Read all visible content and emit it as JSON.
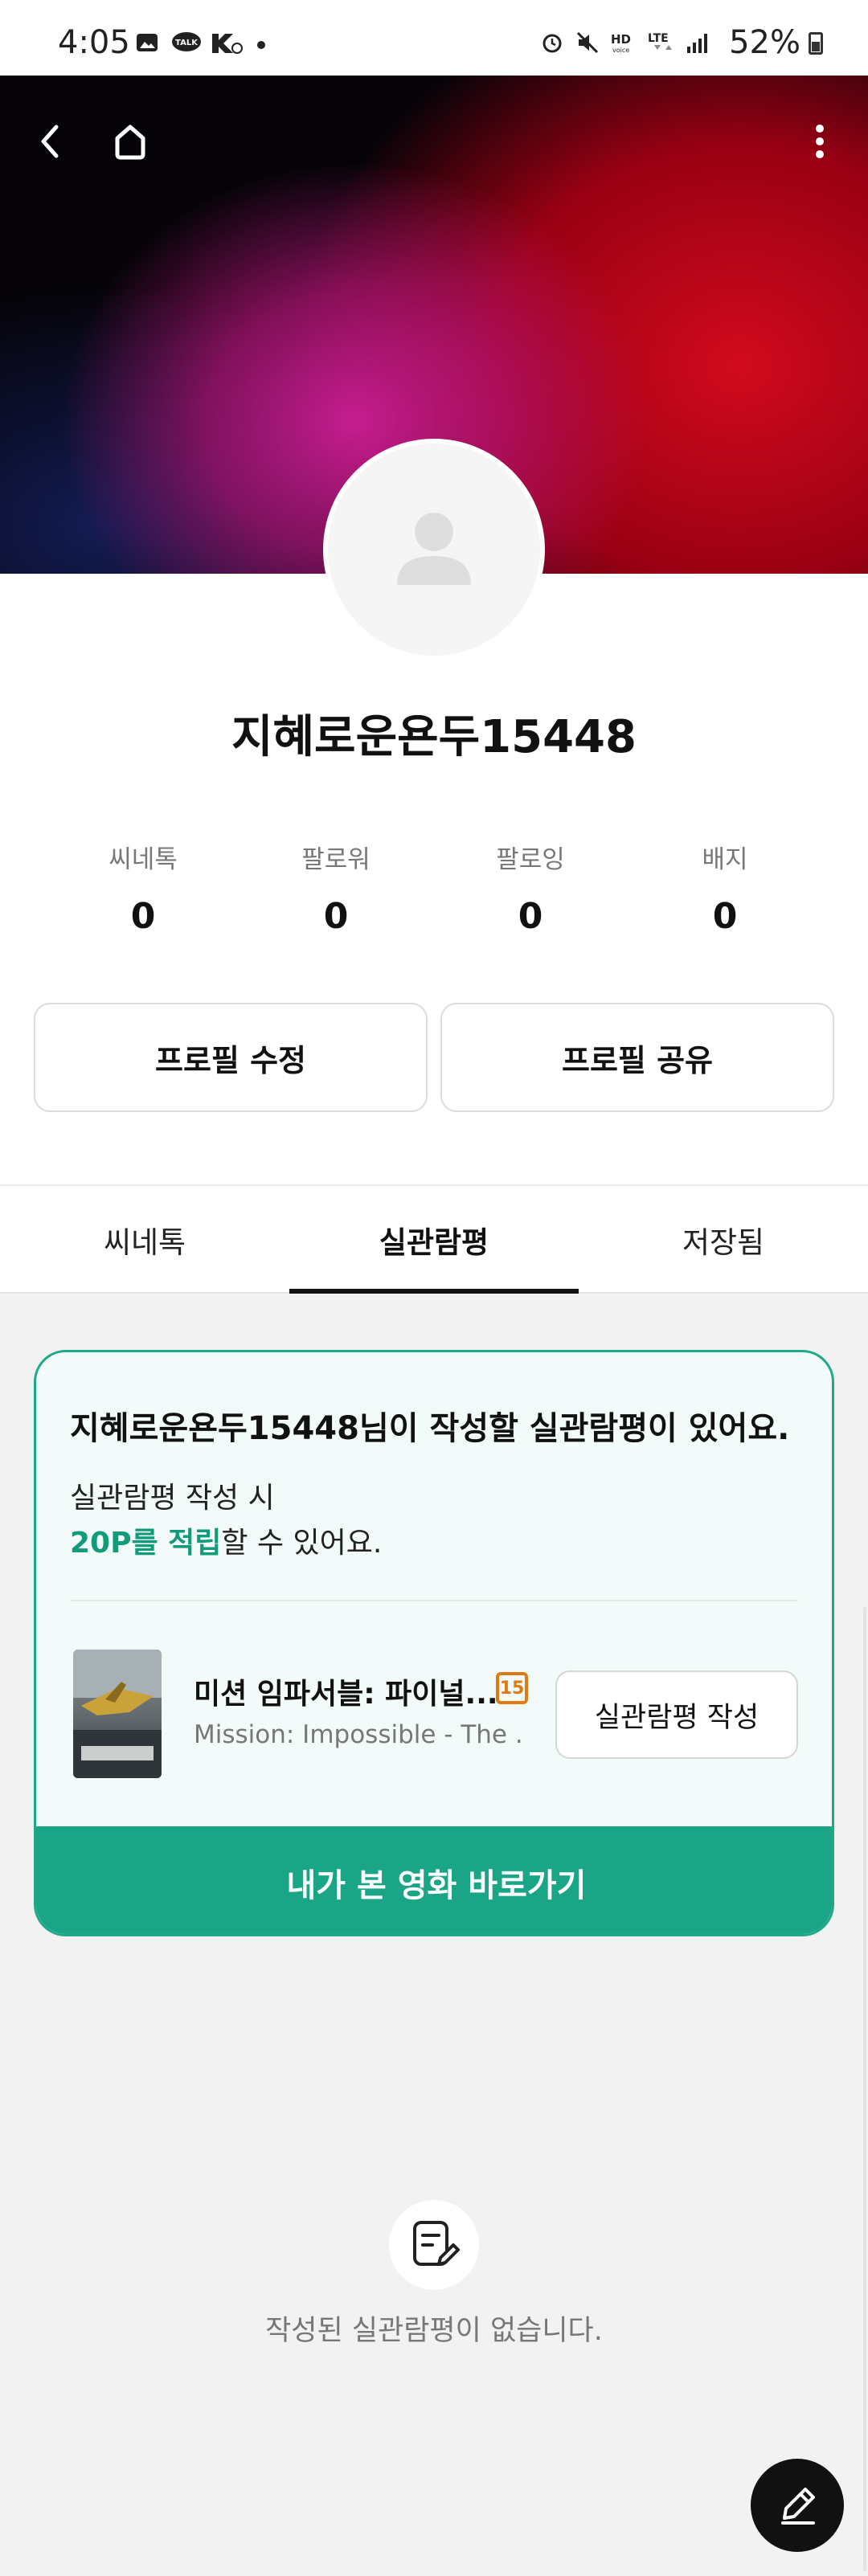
{
  "status_bar": {
    "time": "4:05",
    "battery": "52%",
    "icons": [
      "image-icon",
      "talk-icon",
      "k5-icon",
      "dot-icon",
      "alarm-icon",
      "mute-icon",
      "hd-voice-icon",
      "lte-icon",
      "signal-icon"
    ]
  },
  "banner": {
    "back_icon": "chevron-left-icon",
    "home_icon": "home-icon",
    "more_icon": "more-vertical-icon"
  },
  "profile": {
    "username": "지혜로운욘두15448",
    "stats": [
      {
        "label": "씨네톡",
        "value": "0"
      },
      {
        "label": "팔로워",
        "value": "0"
      },
      {
        "label": "팔로잉",
        "value": "0"
      },
      {
        "label": "배지",
        "value": "0"
      }
    ],
    "edit_button": "프로필 수정",
    "share_button": "프로필 공유"
  },
  "tabs": [
    {
      "label": "씨네톡",
      "active": false
    },
    {
      "label": "실관람평",
      "active": true
    },
    {
      "label": "저장됨",
      "active": false
    }
  ],
  "card": {
    "title": "지혜로운욘두15448님이 작성할 실관람평이 있어요.",
    "line1": "실관람평 작성 시",
    "highlight": "20P를 적립",
    "line2_rest": "할 수 있어요.",
    "movie": {
      "title": "미션 임파서블: 파이널...",
      "subtitle": "Mission: Impossible - The ...",
      "age_rating": "15"
    },
    "write_button": "실관람평 작성",
    "cta": "내가 본 영화 바로가기"
  },
  "empty_state": {
    "text": "작성된 실관람평이 없습니다."
  },
  "colors": {
    "accent": "#1aa586",
    "highlight_text": "#129b7b",
    "age_badge": "#e07b13"
  }
}
